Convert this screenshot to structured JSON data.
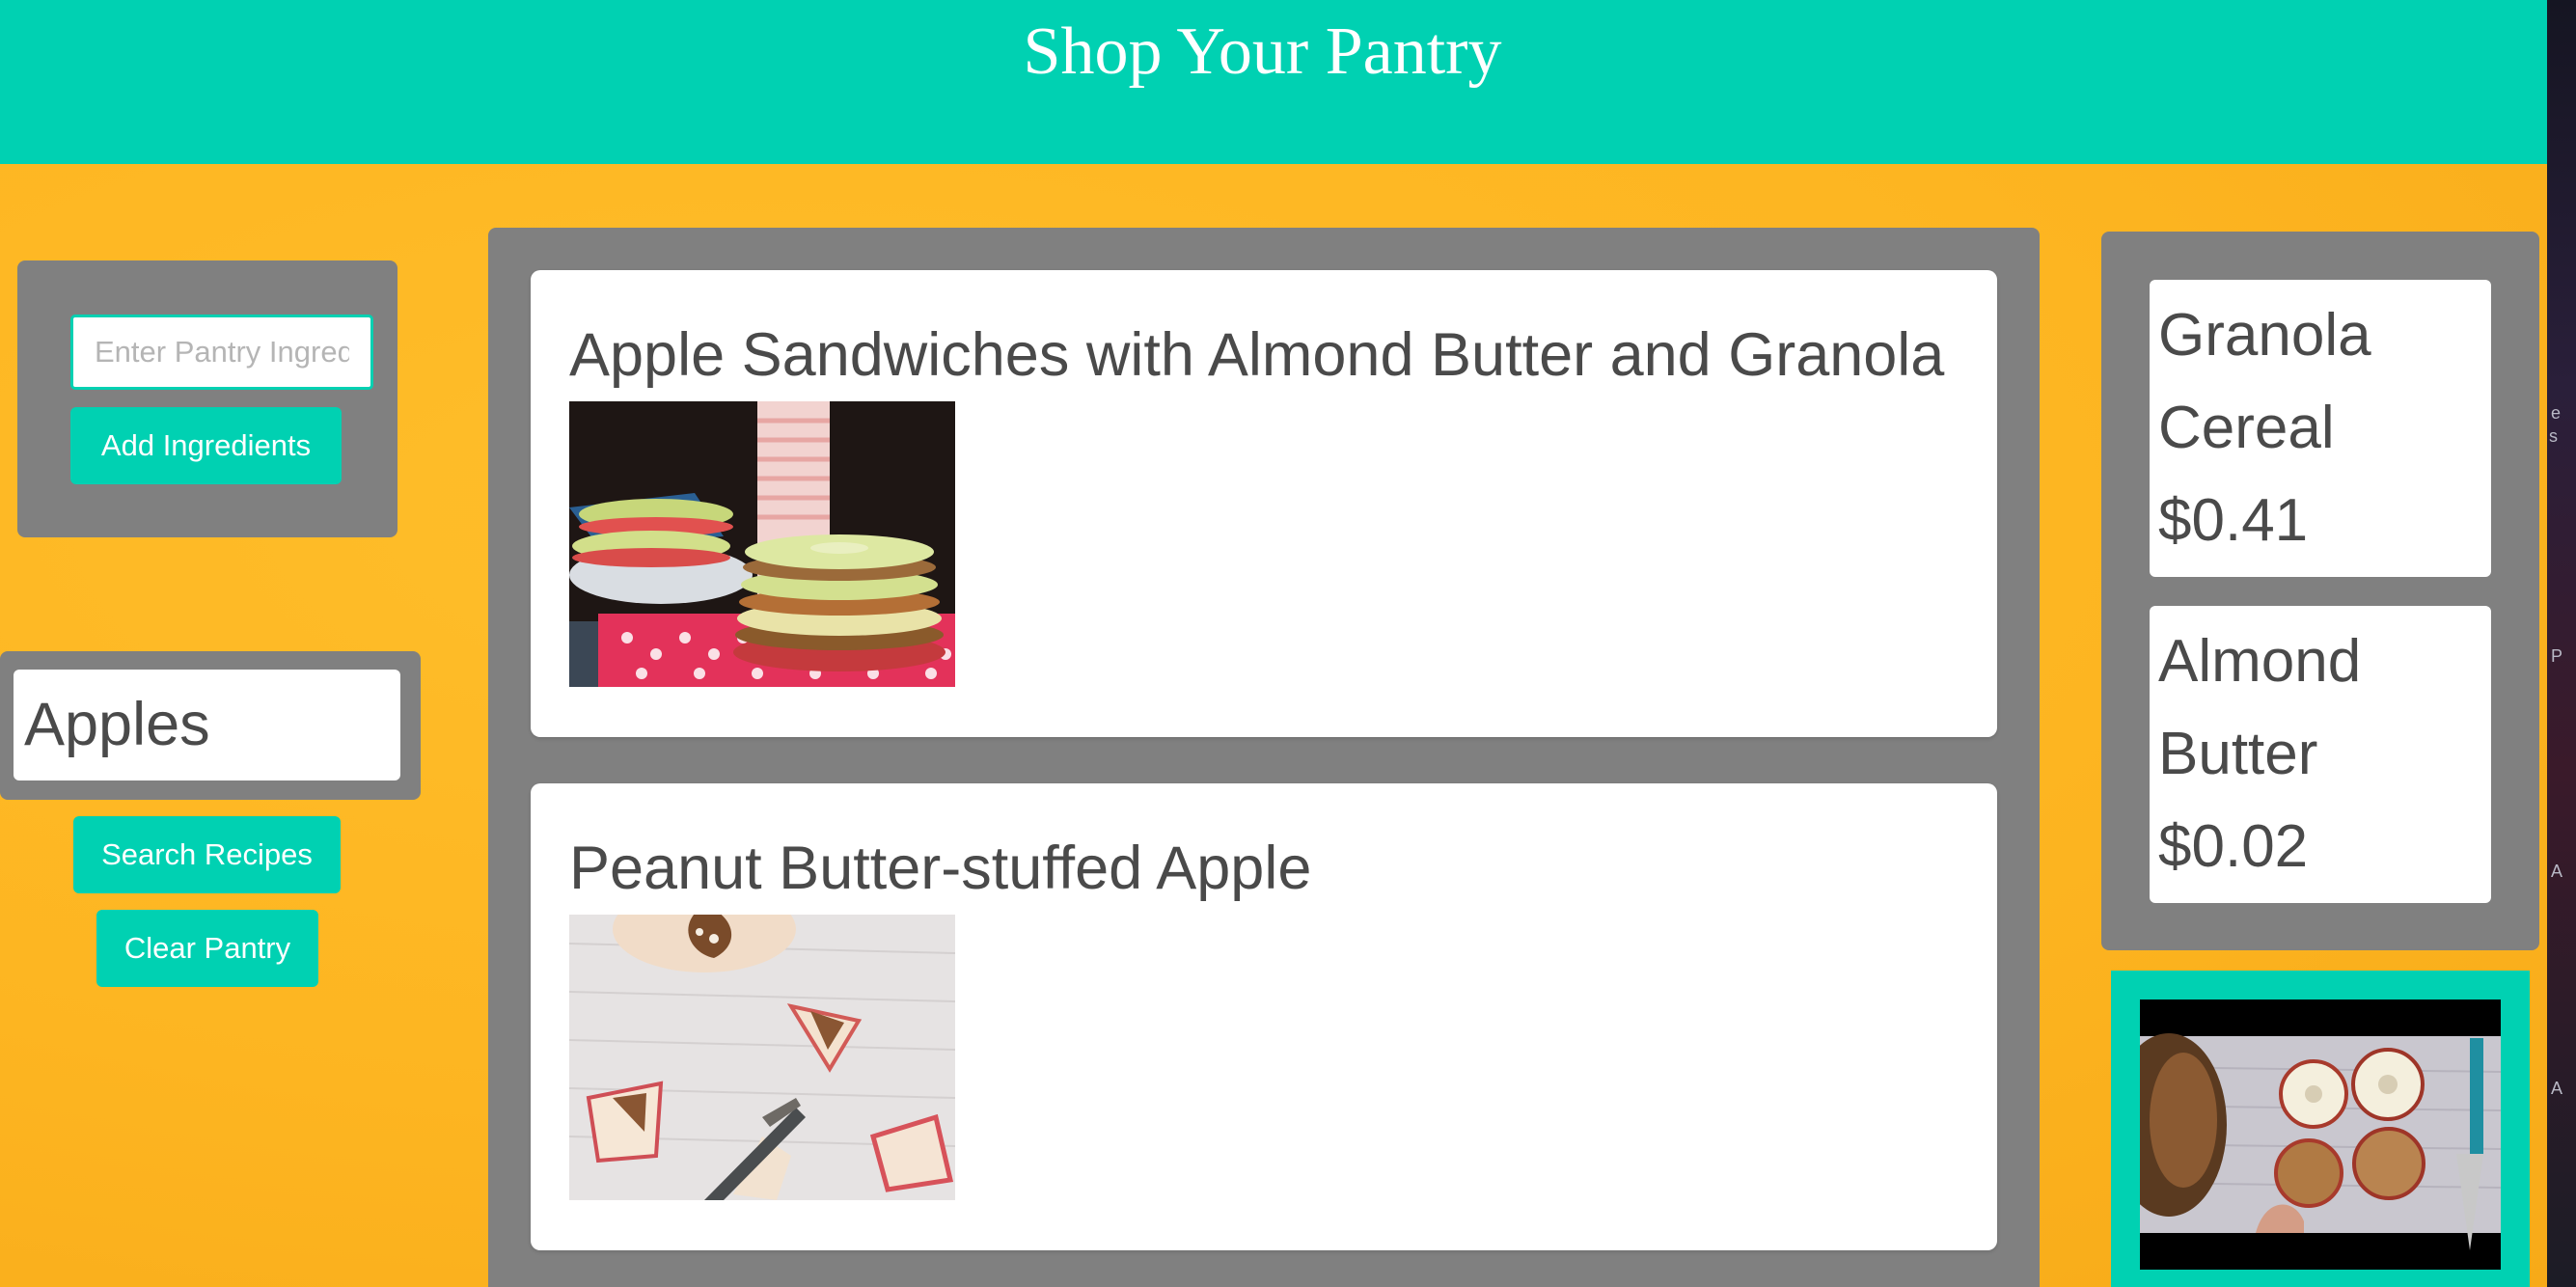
{
  "header": {
    "title": "Shop Your Pantry"
  },
  "pantry_form": {
    "input_placeholder": "Enter Pantry Ingredients",
    "input_value": "",
    "add_button_label": "Add Ingredients"
  },
  "pantry": {
    "items": [
      {
        "label": "Apples"
      }
    ]
  },
  "actions": {
    "search_button_label": "Search Recipes",
    "clear_button_label": "Clear Pantry"
  },
  "recipes": [
    {
      "title": "Apple Sandwiches with Almond Butter and Granola",
      "image": "apple-sandwich-photo"
    },
    {
      "title": "Peanut Butter-stuffed Apple",
      "image": "stuffed-apple-photo"
    }
  ],
  "shopping_list": [
    {
      "name_line1": "Granola",
      "name_line2": "Cereal",
      "price": "$0.41"
    },
    {
      "name_line1": "Almond",
      "name_line2": "Butter",
      "price": "$0.02"
    }
  ],
  "video": {
    "thumbnail": "video-thumbnail-apple-slices"
  },
  "colors": {
    "header": "#00d1b2",
    "background": "#fdb521",
    "panel": "#808080",
    "button": "#00d1b2",
    "text": "#4a4a4a"
  }
}
